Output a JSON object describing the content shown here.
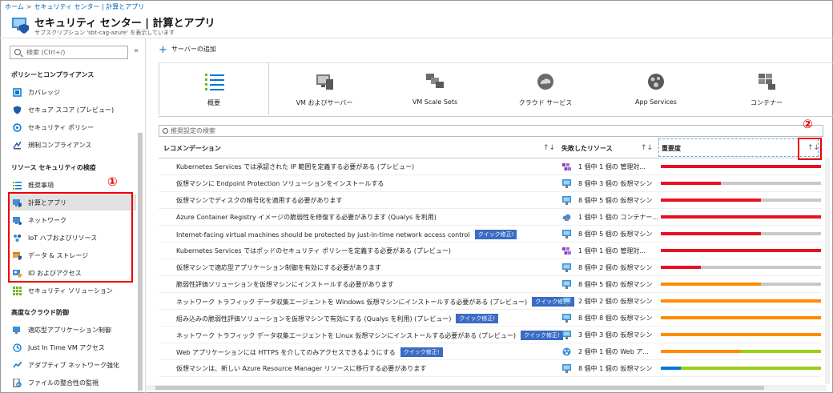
{
  "breadcrumb": {
    "home": "ホーム",
    "middle": "セキュリティ センター | 計算とアプリ",
    "current": ""
  },
  "header": {
    "title": "セキュリティ センター | 計算とアプリ",
    "subtitle": "サブスクリプション 'sbt-cag-azure' を表示しています"
  },
  "sidebar": {
    "search_placeholder": "検索 (Ctrl+/)",
    "collapse": "«",
    "sections": [
      {
        "title": "ポリシーとコンプライアンス"
      },
      {
        "title": "リソース セキュリティの検疫"
      },
      {
        "title": "高度なクラウド防御"
      }
    ],
    "items": [
      {
        "label": "カバレッジ"
      },
      {
        "label": "セキュア スコア (プレビュー)"
      },
      {
        "label": "セキュリティ ポリシー"
      },
      {
        "label": "規制コンプライアンス"
      },
      {
        "label": "推奨事項"
      },
      {
        "label": "計算とアプリ"
      },
      {
        "label": "ネットワーク"
      },
      {
        "label": "IoT ハブおよびリソース"
      },
      {
        "label": "データ & ストレージ"
      },
      {
        "label": "ID およびアクセス"
      },
      {
        "label": "セキュリティ ソリューション"
      },
      {
        "label": "適応型アプリケーション制御"
      },
      {
        "label": "Just In Time VM アクセス"
      },
      {
        "label": "アダプティブ ネットワーク強化"
      },
      {
        "label": "ファイルの整合性の監視"
      }
    ],
    "active_item": "計算とアプリ"
  },
  "annotations": {
    "one": "①",
    "two": "②"
  },
  "toolbar": {
    "add_server": "サーバーの追加"
  },
  "tabs": [
    {
      "label": "概要",
      "icon": "overview-icon"
    },
    {
      "label": "VM およびサーバー",
      "icon": "vm-icon"
    },
    {
      "label": "VM Scale Sets",
      "icon": "scale-set-icon"
    },
    {
      "label": "クラウド サービス",
      "icon": "cloud-service-icon"
    },
    {
      "label": "App Services",
      "icon": "app-service-icon"
    },
    {
      "label": "コンテナー",
      "icon": "container-icon"
    }
  ],
  "table": {
    "search_placeholder": "推奨設定の検索",
    "headers": {
      "recommendation": "レコメンデーション",
      "failed": "失敗したリソース",
      "severity": "重要度"
    },
    "sort_glyph": "↑↓",
    "quick_fix": "クイック修正!",
    "colors": {
      "high": "#e81123",
      "medium": "#ff8c00",
      "low": "#9bcf18",
      "blue": "#0078d4",
      "gray": "#c8c8c8"
    },
    "rows": [
      {
        "recommendation": "Kubernetes Services では承認された IP 範囲を定義する必要がある (プレビュー)",
        "quick": false,
        "res_icon": "kubernetes-icon",
        "failed": "1 個中 1 個の 管理対...",
        "severity": "high",
        "fail_fraction": 1.0
      },
      {
        "recommendation": "仮想マシンに Endpoint Protection ソリューションをインストールする",
        "quick": false,
        "res_icon": "vm-icon",
        "failed": "8 個中 3 個の 仮想マシン",
        "severity": "high",
        "fail_fraction": 0.375
      },
      {
        "recommendation": "仮想マシンでディスクの暗号化を適用する必要があります",
        "quick": false,
        "res_icon": "vm-icon",
        "failed": "8 個中 5 個の 仮想マシン",
        "severity": "high",
        "fail_fraction": 0.625
      },
      {
        "recommendation": "Azure Container Registry イメージの脆弱性を修復する必要があります (Qualys を利用)",
        "quick": false,
        "res_icon": "container-registry-icon",
        "failed": "1 個中 1 個の コンテナー...",
        "severity": "high",
        "fail_fraction": 1.0
      },
      {
        "recommendation": "Internet-facing virtual machines should be protected by just-in-time network access control",
        "quick": true,
        "res_icon": "vm-icon",
        "failed": "8 個中 5 個の 仮想マシン",
        "severity": "high",
        "fail_fraction": 0.625
      },
      {
        "recommendation": "Kubernetes Services ではポッドのセキュリティ ポリシーを定義する必要がある (プレビュー)",
        "quick": false,
        "res_icon": "kubernetes-icon",
        "failed": "1 個中 1 個の 管理対...",
        "severity": "high",
        "fail_fraction": 1.0
      },
      {
        "recommendation": "仮想マシンで適応型アプリケーション制御を有効にする必要があります",
        "quick": false,
        "res_icon": "vm-icon",
        "failed": "8 個中 2 個の 仮想マシン",
        "severity": "high",
        "fail_fraction": 0.25
      },
      {
        "recommendation": "脆弱性評価ソリューションを仮想マシンにインストールする必要があります",
        "quick": false,
        "res_icon": "vm-icon",
        "failed": "8 個中 5 個の 仮想マシン",
        "severity": "medium",
        "fail_fraction": 0.625
      },
      {
        "recommendation": "ネットワーク トラフィック データ収集エージェントを Windows 仮想マシンにインストールする必要がある (プレビュー)",
        "quick": true,
        "res_icon": "vm-icon",
        "failed": "2 個中 2 個の 仮想マシン",
        "severity": "medium",
        "fail_fraction": 1.0
      },
      {
        "recommendation": "組み込みの脆弱性評価ソリューションを仮想マシンで有効にする (Qualys を利用) (プレビュー)",
        "quick": true,
        "res_icon": "vm-icon",
        "failed": "8 個中 8 個の 仮想マシン",
        "severity": "medium",
        "fail_fraction": 1.0
      },
      {
        "recommendation": "ネットワーク トラフィック データ収集エージェントを Linux 仮想マシンにインストールする必要がある (プレビュー)",
        "quick": true,
        "res_icon": "vm-icon",
        "failed": "3 個中 3 個の 仮想マシン",
        "severity": "medium",
        "fail_fraction": 1.0
      },
      {
        "recommendation": "Web アプリケーションには HTTPS を介してのみアクセスできるようにする",
        "quick": true,
        "res_icon": "web-app-icon",
        "failed": "2 個中 1 個の Web ア...",
        "severity": "medium-low",
        "fail_fraction": 0.5
      },
      {
        "recommendation": "仮想マシンは、新しい Azure Resource Manager リソースに移行する必要があります",
        "quick": false,
        "res_icon": "vm-icon",
        "failed": "8 個中 1 個の 仮想マシン",
        "severity": "low",
        "fail_fraction": 0.125
      }
    ]
  }
}
